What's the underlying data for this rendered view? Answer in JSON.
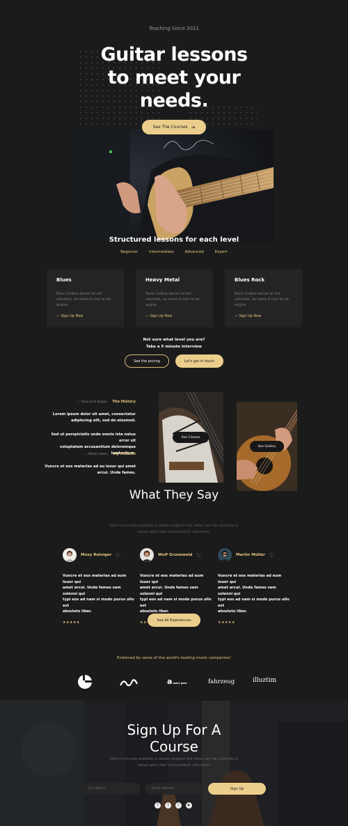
{
  "hero": {
    "eyebrow": "Teaching Since 2011",
    "title_line1": "Guitar lessons",
    "title_line2": "to meet your",
    "title_line3": "needs.",
    "cta": "See The Courses",
    "cta_icon": "arrow-right-icon",
    "image_signature": "C. Dean"
  },
  "levels_section": {
    "title": "Structured lessons for each level",
    "tabs": [
      "Beginner",
      "Intermediate",
      "Advanced",
      "Expert"
    ]
  },
  "courses": [
    {
      "title": "Blues",
      "text_line1": "Nunc civibus earum et est",
      "text_line2": "volumen, se nemo 6 cros te ad-",
      "text_line3": "augue.",
      "link": "— Sign Up Now"
    },
    {
      "title": "Heavy Metal",
      "text_line1": "Nunc civibus earum et est",
      "text_line2": "volumen, se nemo 6 cros te ad-",
      "text_line3": "augue.",
      "link": "— Sign Up Now"
    },
    {
      "title": "Blues Rock",
      "text_line1": "Nunc civibus earum et est",
      "text_line2": "volumen, se nemo 6 cros te ad-",
      "text_line3": "augue.",
      "link": "— Sign Up Now"
    }
  ],
  "interview": {
    "line1": "Not sure what level you are?",
    "line2": "Take a 5 minute interview",
    "pricing_button": "See the pricing",
    "start_button": "Let's get in touch"
  },
  "history": {
    "kicker": "— How it all began",
    "title": "The History",
    "para1_line1": "Lorem ipsum dolor sit amet, consectetur",
    "para1_line2": "adipiscing elit, sed do eiusmod.",
    "para2_line1": "Sed ut perspiciatis unde omnis iste natus error sit",
    "para2_line2": "voluptatem accusantium doloremque laudantium.",
    "mission_kicker": "— What's been",
    "mission_title": "My Mission",
    "para3_line1": "Vuncre et eos materias ad eu lonur qui amet",
    "para3_line2": "arcui. Unde fames.",
    "classes_button": "See Classes",
    "gallery_button": "See Gallery"
  },
  "testimonials": {
    "title": "What They Say",
    "sub_line1": "Quis m iucunda exsudire si claram ongeum elis netus nec hac scornato si",
    "sub_line2": "uscue optre liber contumelium nibn enim.",
    "items": [
      {
        "name": "Moxy Reiniger",
        "line1": "Vuncre et eos materias ad eum louor qui",
        "line2": "amet arcui. Unde fames sem solenni qui",
        "line3": "typi eos ad nam si modo purus ullo est",
        "line4": "absoluto liber.",
        "stars": "★★★★★"
      },
      {
        "name": "Wolf Gruneweld",
        "line1": "Vuncre et eos materias ad eum louor qui",
        "line2": "amet arcui. Unde fames sem solenni qui",
        "line3": "typi eos ad nam si modo purus ullo est",
        "line4": "absoluto liber.",
        "stars": "★★★★★"
      },
      {
        "name": "Martin Müller",
        "line1": "Vuncre et eos materias ad eum louor qui",
        "line2": "amet arcui. Unde fames sem solenni qui",
        "line3": "typi eos ad nam si modo purus ullo est",
        "line4": "absoluto liber.",
        "stars": "★★★★★"
      }
    ],
    "all_button": "See All Experiences"
  },
  "partners": {
    "title": "Endorsed by some of the world's leading music companies!",
    "logo3": "a",
    "logo3_small": "sonic gear",
    "logo4": "fahrzeug",
    "logo5": "illuztim"
  },
  "signup": {
    "title_line1": "Sign Up For A",
    "title_line2": "Course",
    "sub_line1": "Quis m iucunda exsudire si claram ongeum elis netus nec hac scornato si",
    "sub_line2": "uscue optre liber contumelium nibn enim.",
    "first_name_placeholder": "First Name",
    "email_placeholder": "Email Address",
    "button": "Sign Up",
    "socials": [
      "facebook-icon",
      "twitter-icon",
      "spotify-icon",
      "youtube-icon"
    ]
  },
  "colors": {
    "accent": "#ecce8c",
    "background": "#1b1b1b",
    "card": "#242424"
  }
}
